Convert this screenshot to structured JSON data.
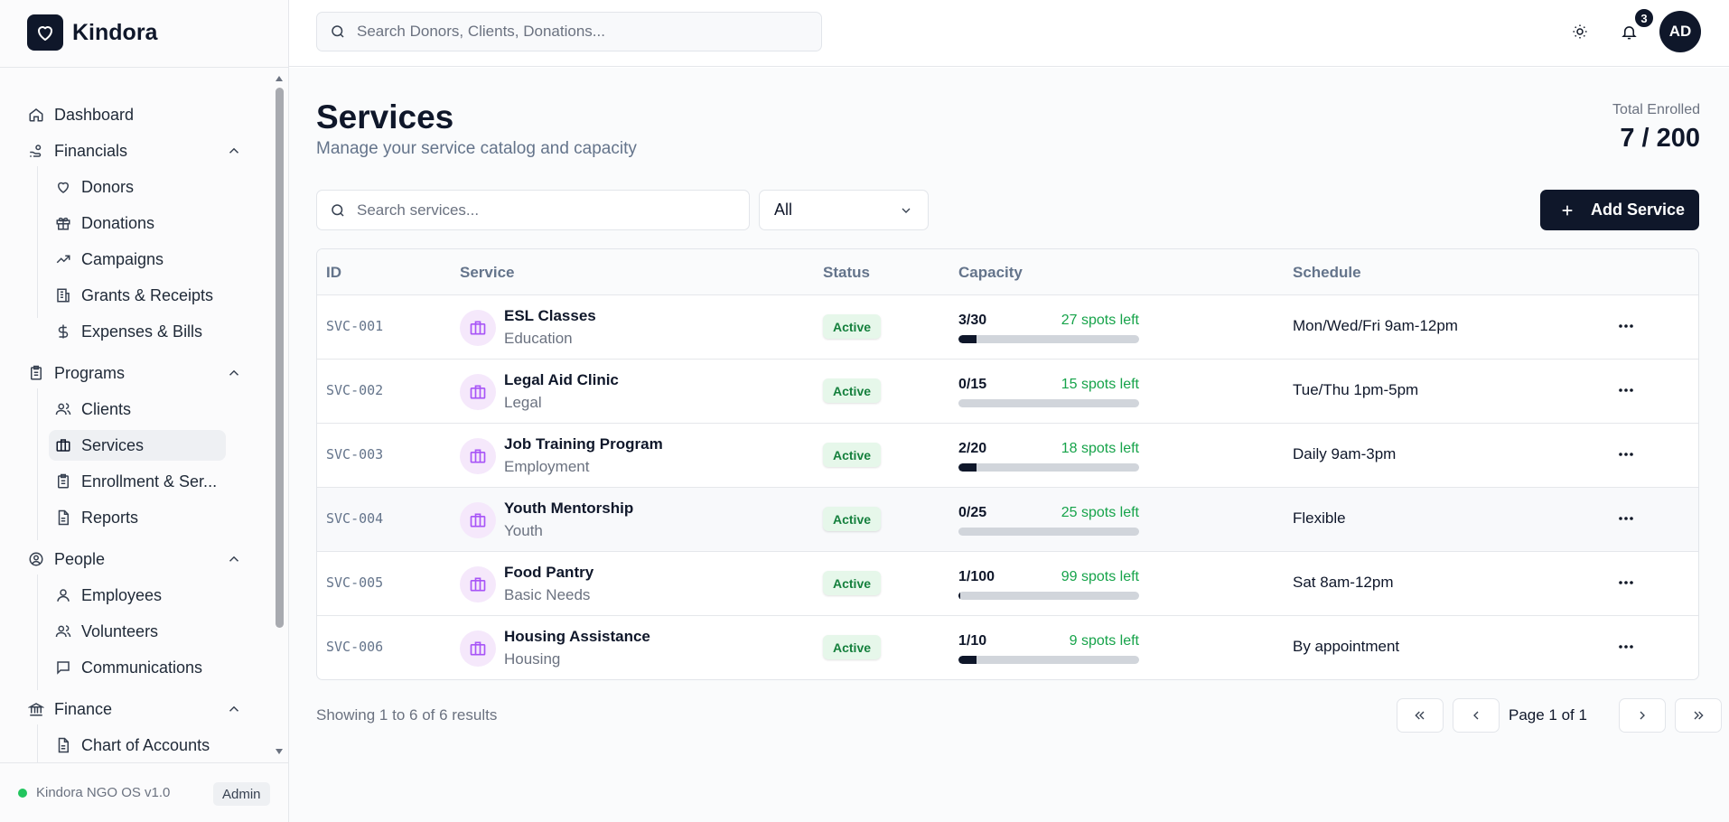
{
  "brand": {
    "name": "Kindora"
  },
  "header": {
    "search_placeholder": "Search Donors, Clients, Donations...",
    "notification_count": "3",
    "avatar_initials": "AD"
  },
  "sidebar": {
    "dashboard": "Dashboard",
    "financials": {
      "label": "Financials",
      "items": [
        "Donors",
        "Donations",
        "Campaigns",
        "Grants & Receipts",
        "Expenses & Bills"
      ]
    },
    "programs": {
      "label": "Programs",
      "items": [
        "Clients",
        "Services",
        "Enrollment & Ser...",
        "Reports"
      ],
      "active": "Services"
    },
    "people": {
      "label": "People",
      "items": [
        "Employees",
        "Volunteers",
        "Communications"
      ]
    },
    "finance": {
      "label": "Finance",
      "items": [
        "Chart of Accounts"
      ]
    },
    "footer": {
      "version": "Kindora NGO OS v1.0",
      "role": "Admin"
    }
  },
  "page": {
    "title": "Services",
    "subtitle": "Manage your service catalog and capacity",
    "enrolled_label": "Total Enrolled",
    "enrolled_value": "7 / 200"
  },
  "toolbar": {
    "search_placeholder": "Search services...",
    "filter_value": "All",
    "add_label": "Add Service"
  },
  "table": {
    "columns": [
      "ID",
      "Service",
      "Status",
      "Capacity",
      "Schedule"
    ],
    "rows": [
      {
        "id": "SVC-001",
        "name": "ESL Classes",
        "category": "Education",
        "status": "Active",
        "capacity": "3/30",
        "spots": "27 spots left",
        "fill": 0.1,
        "schedule": "Mon/Wed/Fri 9am-12pm"
      },
      {
        "id": "SVC-002",
        "name": "Legal Aid Clinic",
        "category": "Legal",
        "status": "Active",
        "capacity": "0/15",
        "spots": "15 spots left",
        "fill": 0,
        "schedule": "Tue/Thu 1pm-5pm"
      },
      {
        "id": "SVC-003",
        "name": "Job Training Program",
        "category": "Employment",
        "status": "Active",
        "capacity": "2/20",
        "spots": "18 spots left",
        "fill": 0.1,
        "schedule": "Daily 9am-3pm"
      },
      {
        "id": "SVC-004",
        "name": "Youth Mentorship",
        "category": "Youth",
        "status": "Active",
        "capacity": "0/25",
        "spots": "25 spots left",
        "fill": 0,
        "schedule": "Flexible"
      },
      {
        "id": "SVC-005",
        "name": "Food Pantry",
        "category": "Basic Needs",
        "status": "Active",
        "capacity": "1/100",
        "spots": "99 spots left",
        "fill": 0.01,
        "schedule": "Sat 8am-12pm"
      },
      {
        "id": "SVC-006",
        "name": "Housing Assistance",
        "category": "Housing",
        "status": "Active",
        "capacity": "1/10",
        "spots": "9 spots left",
        "fill": 0.1,
        "schedule": "By appointment"
      }
    ]
  },
  "pagination": {
    "showing": "Showing 1 to 6 of 6 results",
    "page_label": "Page 1 of 1"
  },
  "colors": {
    "primary": "#0f172a",
    "success": "#16a34a",
    "accent_purple": "#a855f7"
  },
  "icons": {
    "logo": "heart-icon",
    "search": "search-icon",
    "theme": "sun-icon",
    "bell": "bell-icon",
    "row_menu": "more-horizontal-icon",
    "service": "briefcase-icon"
  }
}
